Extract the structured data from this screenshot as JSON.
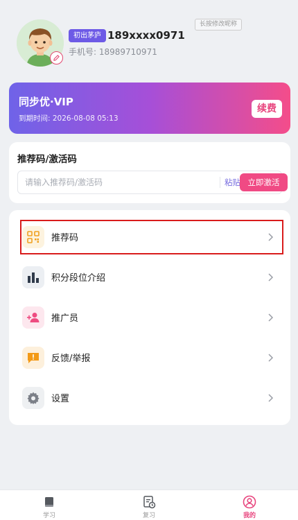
{
  "profile": {
    "level_badge": "初出茅庐",
    "username": "189xxxx0971",
    "phone": "手机号: 18989710971",
    "hint": "长按修改昵称"
  },
  "vip": {
    "title": "同步优·VIP",
    "expiry": "到期时间: 2026-08-08 05:13",
    "renew_label": "续费"
  },
  "code_card": {
    "title": "推荐码/激活码",
    "input_placeholder": "请输入推荐码/激活码",
    "input_value": "",
    "paste_label": "粘贴",
    "activate_label": "立即激活"
  },
  "menu": {
    "items": [
      {
        "label": "推荐码",
        "icon": "qr-code-icon",
        "icon_color": "#f0a020",
        "icon_bg": "#fdf3df"
      },
      {
        "label": "积分段位介绍",
        "icon": "bar-chart-icon",
        "icon_color": "#2f3a4a",
        "icon_bg": "#eceff3"
      },
      {
        "label": "推广员",
        "icon": "add-person-icon",
        "icon_color": "#ee4b80",
        "icon_bg": "#fde7ee"
      },
      {
        "label": "反馈/举报",
        "icon": "feedback-icon",
        "icon_color": "#f39a16",
        "icon_bg": "#fdf0dc"
      },
      {
        "label": "设置",
        "icon": "gear-icon",
        "icon_color": "#7b7f87",
        "icon_bg": "#eef0f2"
      }
    ]
  },
  "tabbar": {
    "tabs": [
      {
        "label": "学习",
        "icon": "book-icon"
      },
      {
        "label": "复习",
        "icon": "review-icon"
      },
      {
        "label": "我的",
        "icon": "person-icon",
        "active": true
      }
    ]
  },
  "colors": {
    "accent_pink": "#f04a84",
    "accent_purple": "#6d5ae6",
    "highlight_red": "#d91b1b"
  }
}
